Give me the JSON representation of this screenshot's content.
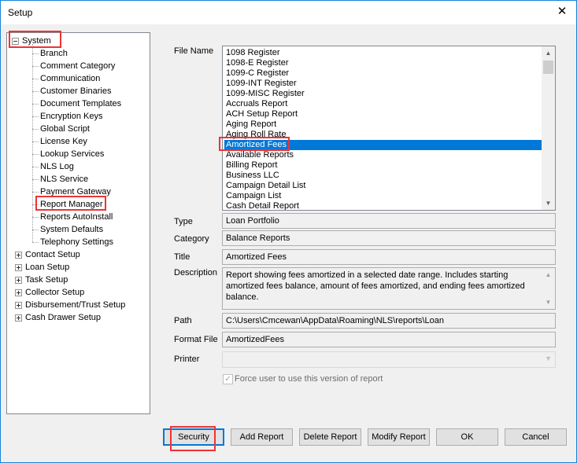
{
  "window": {
    "title": "Setup",
    "close_icon": "close-icon"
  },
  "tree": {
    "root": "System",
    "children": [
      "Branch",
      "Comment Category",
      "Communication",
      "Customer Binaries",
      "Document Templates",
      "Encryption Keys",
      "Global Script",
      "License Key",
      "Lookup Services",
      "NLS Log",
      "NLS Service",
      "Payment Gateway",
      "Report Manager",
      "Reports AutoInstall",
      "System Defaults",
      "Telephony Settings"
    ],
    "groups": [
      "Contact Setup",
      "Loan Setup",
      "Task Setup",
      "Collector Setup",
      "Disbursement/Trust Setup",
      "Cash Drawer Setup"
    ]
  },
  "labels": {
    "file_name": "File Name",
    "type": "Type",
    "category": "Category",
    "title": "Title",
    "description": "Description",
    "path": "Path",
    "format_file": "Format File",
    "printer": "Printer"
  },
  "files": [
    "1098 Register",
    "1098-E Register",
    "1099-C Register",
    "1099-INT Register",
    "1099-MISC Register",
    "Accruals Report",
    "ACH Setup Report",
    "Aging Report",
    "Aging Roll Rate",
    "Amortized Fees",
    "Available Reports",
    "Billing Report",
    "Business LLC",
    "Campaign Detail List",
    "Campaign List",
    "Cash Detail Report"
  ],
  "selected_file": "Amortized Fees",
  "fields": {
    "type": "Loan Portfolio",
    "category": "Balance Reports",
    "title": "Amortized Fees",
    "description": "Report showing fees amortized in a selected date range. Includes starting amortized fees balance, amount of fees amortized, and ending fees amortized balance.",
    "path": "C:\\Users\\Cmcewan\\AppData\\Roaming\\NLS\\reports\\Loan",
    "format_file": "AmortizedFees",
    "printer": ""
  },
  "force_checkbox": {
    "label": "Force user to use this version of report",
    "checked": true
  },
  "buttons": {
    "security": "Security",
    "add_report": "Add Report",
    "delete_report": "Delete Report",
    "modify_report": "Modify Report",
    "ok": "OK",
    "cancel": "Cancel"
  },
  "colors": {
    "selection": "#0078d7",
    "highlight_box": "#e33333",
    "window_border": "#1883d7"
  }
}
